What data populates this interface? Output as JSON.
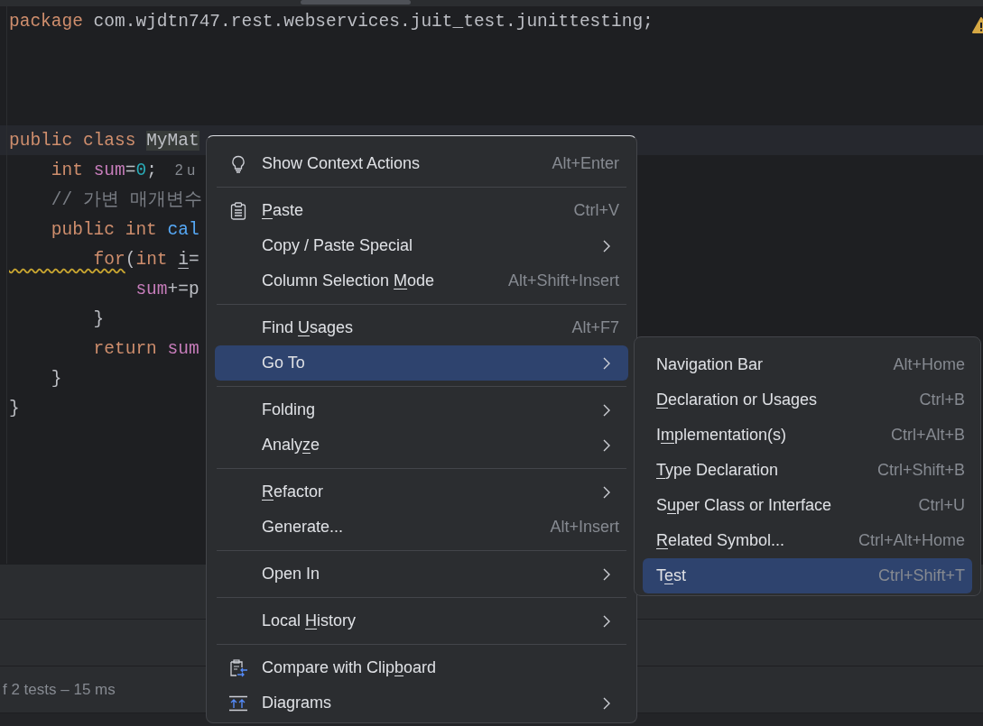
{
  "editor": {
    "lines": [
      {
        "current": false,
        "tokens": [
          {
            "text": "package",
            "kind": "keyword"
          },
          {
            "text": " com.wjdtn747.rest.webservices.juit_test.junittesting;",
            "kind": "plain"
          }
        ]
      },
      {
        "current": false
      },
      {
        "current": false
      },
      {
        "current": false
      },
      {
        "current": true,
        "tokens": [
          {
            "text": "public class ",
            "kind": "keyword"
          },
          {
            "text": "MyMat",
            "kind": "class"
          }
        ]
      },
      {
        "current": false,
        "tokens": [
          {
            "text": "    int ",
            "kind": "keyword"
          },
          {
            "text": "sum",
            "kind": "field"
          },
          {
            "text": "=",
            "kind": "plain"
          },
          {
            "text": "0",
            "kind": "number"
          },
          {
            "text": ";",
            "kind": "plain"
          },
          {
            "text": "2 u",
            "kind": "hint"
          }
        ]
      },
      {
        "current": false,
        "tokens": [
          {
            "text": "    // 가변 매개변수",
            "kind": "comment"
          }
        ]
      },
      {
        "current": false,
        "tokens": [
          {
            "text": "    public int ",
            "kind": "keyword"
          },
          {
            "text": "cal",
            "kind": "method"
          }
        ]
      },
      {
        "current": false,
        "tokens": [
          {
            "text": "        for",
            "kind": "keyword",
            "warning": true
          },
          {
            "text": "(",
            "kind": "plain"
          },
          {
            "text": "int ",
            "kind": "keyword"
          },
          {
            "text": "i",
            "kind": "plain",
            "underlined": true
          },
          {
            "text": "=",
            "kind": "plain"
          }
        ]
      },
      {
        "current": false,
        "tokens": [
          {
            "text": "            sum",
            "kind": "field"
          },
          {
            "text": "+=p",
            "kind": "plain"
          }
        ]
      },
      {
        "current": false,
        "tokens": [
          {
            "text": "        }",
            "kind": "plain"
          }
        ]
      },
      {
        "current": false,
        "tokens": [
          {
            "text": "        return ",
            "kind": "keyword"
          },
          {
            "text": "sum",
            "kind": "field"
          }
        ]
      },
      {
        "current": false,
        "tokens": [
          {
            "text": "    }",
            "kind": "plain"
          }
        ]
      },
      {
        "current": false,
        "tokens": [
          {
            "text": "}",
            "kind": "plain"
          }
        ]
      }
    ]
  },
  "test_status": "f 2 tests – 15 ms",
  "context_menu": {
    "items": [
      {
        "kind": "item",
        "label": [
          {
            "text": "Show Context Actions",
            "underlined": false
          }
        ],
        "shortcut": "Alt+Enter",
        "submenu": false,
        "selected": false
      },
      {
        "kind": "separator"
      },
      {
        "kind": "item",
        "label": [
          {
            "text": "P",
            "underlined": true
          },
          {
            "text": "aste",
            "underlined": false
          }
        ],
        "shortcut": "Ctrl+V",
        "submenu": false,
        "selected": false
      },
      {
        "kind": "item",
        "label": [
          {
            "text": "Copy / Paste Special",
            "underlined": false
          }
        ],
        "submenu": true,
        "selected": false
      },
      {
        "kind": "item",
        "label": [
          {
            "text": "Column Selection ",
            "underlined": false
          },
          {
            "text": "M",
            "underlined": true
          },
          {
            "text": "ode",
            "underlined": false
          }
        ],
        "shortcut": "Alt+Shift+Insert",
        "submenu": false,
        "selected": false
      },
      {
        "kind": "separator"
      },
      {
        "kind": "item",
        "label": [
          {
            "text": "Find ",
            "underlined": false
          },
          {
            "text": "U",
            "underlined": true
          },
          {
            "text": "sages",
            "underlined": false
          }
        ],
        "shortcut": "Alt+F7",
        "submenu": false,
        "selected": false
      },
      {
        "kind": "item",
        "label": [
          {
            "text": "Go To",
            "underlined": false
          }
        ],
        "submenu": true,
        "selected": true
      },
      {
        "kind": "separator"
      },
      {
        "kind": "item",
        "label": [
          {
            "text": "Folding",
            "underlined": false
          }
        ],
        "submenu": true,
        "selected": false
      },
      {
        "kind": "item",
        "label": [
          {
            "text": "Analy",
            "underlined": false
          },
          {
            "text": "z",
            "underlined": true
          },
          {
            "text": "e",
            "underlined": false
          }
        ],
        "submenu": true,
        "selected": false
      },
      {
        "kind": "separator"
      },
      {
        "kind": "item",
        "label": [
          {
            "text": "R",
            "underlined": true
          },
          {
            "text": "efactor",
            "underlined": false
          }
        ],
        "submenu": true,
        "selected": false
      },
      {
        "kind": "item",
        "label": [
          {
            "text": "Generate...",
            "underlined": false
          }
        ],
        "shortcut": "Alt+Insert",
        "submenu": false,
        "selected": false
      },
      {
        "kind": "separator"
      },
      {
        "kind": "item",
        "label": [
          {
            "text": "Open In",
            "underlined": false
          }
        ],
        "submenu": true,
        "selected": false
      },
      {
        "kind": "separator"
      },
      {
        "kind": "item",
        "label": [
          {
            "text": "Local ",
            "underlined": false
          },
          {
            "text": "H",
            "underlined": true
          },
          {
            "text": "istory",
            "underlined": false
          }
        ],
        "submenu": true,
        "selected": false
      },
      {
        "kind": "separator"
      },
      {
        "kind": "item",
        "label": [
          {
            "text": "Compare with Clip",
            "underlined": false
          },
          {
            "text": "b",
            "underlined": true
          },
          {
            "text": "oard",
            "underlined": false
          }
        ],
        "submenu": false,
        "selected": false
      },
      {
        "kind": "item",
        "label": [
          {
            "text": "Diagrams",
            "underlined": false
          }
        ],
        "submenu": true,
        "selected": false
      }
    ]
  },
  "submenu": {
    "items": [
      {
        "label": [
          {
            "text": "Navigation Bar",
            "underlined": false
          }
        ],
        "shortcut": "Alt+Home",
        "selected": false
      },
      {
        "label": [
          {
            "text": "D",
            "underlined": true
          },
          {
            "text": "eclaration or Usages",
            "underlined": false
          }
        ],
        "shortcut": "Ctrl+B",
        "selected": false
      },
      {
        "label": [
          {
            "text": "I",
            "underlined": false
          },
          {
            "text": "m",
            "underlined": true
          },
          {
            "text": "plementation(s)",
            "underlined": false
          }
        ],
        "shortcut": "Ctrl+Alt+B",
        "selected": false
      },
      {
        "label": [
          {
            "text": "T",
            "underlined": true
          },
          {
            "text": "ype Declaration",
            "underlined": false
          }
        ],
        "shortcut": "Ctrl+Shift+B",
        "selected": false
      },
      {
        "label": [
          {
            "text": "S",
            "underlined": false
          },
          {
            "text": "u",
            "underlined": true
          },
          {
            "text": "per Class or Interface",
            "underlined": false
          }
        ],
        "shortcut": "Ctrl+U",
        "selected": false
      },
      {
        "label": [
          {
            "text": "R",
            "underlined": true
          },
          {
            "text": "elated Symbol...",
            "underlined": false
          }
        ],
        "shortcut": "Ctrl+Alt+Home",
        "selected": false
      },
      {
        "label": [
          {
            "text": "T",
            "underlined": false
          },
          {
            "text": "e",
            "underlined": true
          },
          {
            "text": "st",
            "underlined": false
          }
        ],
        "shortcut": "Ctrl+Shift+T",
        "selected": true
      }
    ]
  }
}
